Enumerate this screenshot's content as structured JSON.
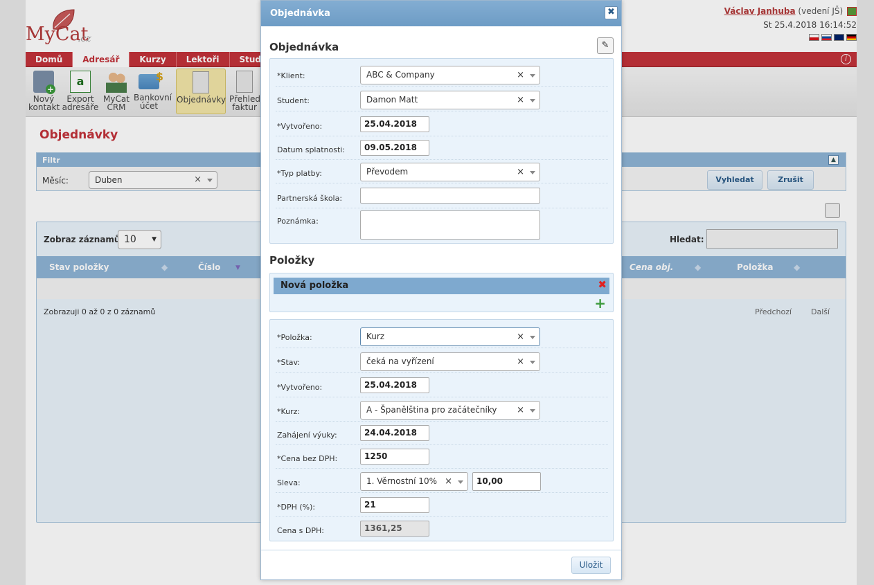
{
  "app": {
    "logo_text": "MyCat",
    "logo_tld": ".cz"
  },
  "user": {
    "name": "Václav Janhuba",
    "role": "(vedení JŠ)",
    "datetime": "St 25.4.2018 16:14:52"
  },
  "colors": {
    "brand": "#c3323a",
    "header_blue": "#8fb5d6"
  },
  "menu": [
    {
      "label": "Domů"
    },
    {
      "label": "Adresář",
      "active": true
    },
    {
      "label": "Kurzy"
    },
    {
      "label": "Lektoři"
    },
    {
      "label": "Stude"
    }
  ],
  "toolbar": {
    "new_contact": "Nový kontakt",
    "export": "Export adresáře",
    "crm": "MyCat CRM",
    "bank": "Bankovní účet",
    "orders": "Objednávky",
    "invoices": "Přehled faktur"
  },
  "page": {
    "title": "Objednávky"
  },
  "filter": {
    "title": "Filtr",
    "month_label": "Měsíc:",
    "month_value": "Duben",
    "search_btn": "Vyhledat",
    "cancel_btn": "Zrušit"
  },
  "grid": {
    "show_label": "Zobraz záznamů",
    "show_value": "10",
    "search_label": "Hledat:",
    "columns": [
      "Stav položky",
      "Číslo",
      "Cena obj.",
      "Položka"
    ],
    "info": "Zobrazuji 0 až 0 z 0 záznamů",
    "prev": "Předchozí",
    "next": "Další"
  },
  "dialog": {
    "title": "Objednávka",
    "section_order": "Objednávka",
    "client_label": "*Klient:",
    "client_value": "ABC & Company",
    "student_label": "Student:",
    "student_value": "Damon Matt",
    "created_label": "*Vytvořeno:",
    "created_value": "25.04.2018",
    "due_label": "Datum splatnosti:",
    "due_value": "09.05.2018",
    "payment_label": "*Typ platby:",
    "payment_value": "Převodem",
    "partner_label": "Partnerská škola:",
    "partner_value": "",
    "note_label": "Poznámka:",
    "note_value": "",
    "section_items": "Položky",
    "new_item": "Nová položka",
    "item_label": "*Položka:",
    "item_value": "Kurz",
    "status_label": "*Stav:",
    "status_value": "čeká na vyřízení",
    "item_created_label": "*Vytvořeno:",
    "item_created_value": "25.04.2018",
    "course_label": "*Kurz:",
    "course_value": "A - Španělština pro začátečníky",
    "start_label": "Zahájení výuky:",
    "start_value": "24.04.2018",
    "price_label": "*Cena bez DPH:",
    "price_value": "1250",
    "discount_label": "Sleva:",
    "discount_value": "1. Věrnostní 10%",
    "discount_amount": "10,00",
    "vat_label": "*DPH (%):",
    "vat_value": "21",
    "total_label": "Cena s DPH:",
    "total_value": "1361,25",
    "save": "Uložit"
  }
}
